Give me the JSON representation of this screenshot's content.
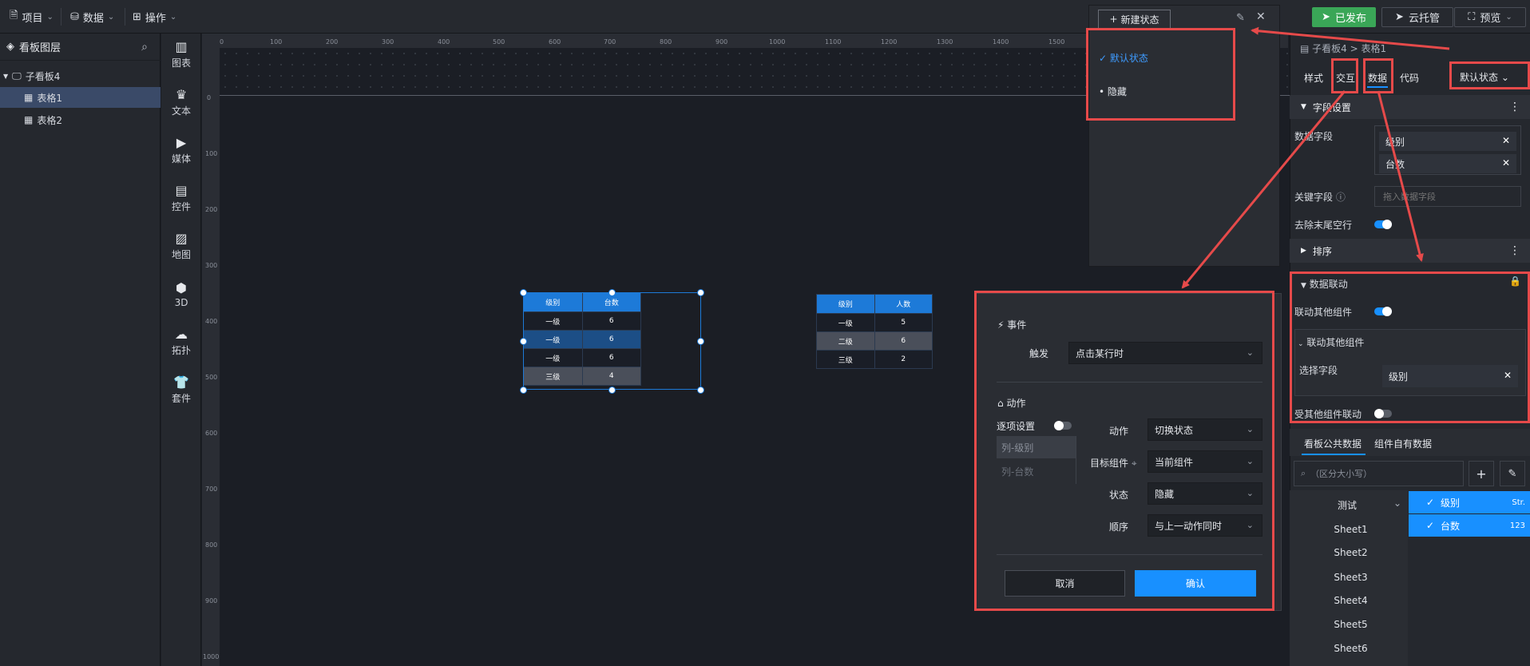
{
  "topbar": {
    "project": "项目",
    "data": "数据",
    "operate": "操作",
    "publish": "已发布",
    "cloud": "云托管",
    "preview": "预览"
  },
  "layers": {
    "title": "看板图层",
    "root": "子看板4",
    "items": [
      "表格1",
      "表格2"
    ]
  },
  "tools": [
    "图表",
    "文本",
    "媒体",
    "控件",
    "地图",
    "3D",
    "拓扑",
    "套件"
  ],
  "ruler": {
    "h": [
      "0",
      "100",
      "200",
      "300",
      "400",
      "500",
      "600",
      "700",
      "800",
      "900",
      "1000",
      "1100",
      "1200",
      "1300",
      "1400",
      "1500"
    ],
    "v": [
      "0",
      "100",
      "200",
      "300",
      "400",
      "500",
      "600",
      "700",
      "800",
      "900",
      "1000"
    ]
  },
  "table1": {
    "headers": [
      "级别",
      "台数"
    ],
    "rows": [
      [
        "一级",
        "6"
      ],
      [
        "一级",
        "6"
      ],
      [
        "一级",
        "6"
      ],
      [
        "三级",
        "4"
      ]
    ]
  },
  "table2": {
    "headers": [
      "级别",
      "人数"
    ],
    "rows": [
      [
        "一级",
        "5"
      ],
      [
        "二级",
        "6"
      ],
      [
        "三级",
        "2"
      ]
    ]
  },
  "state_panel": {
    "new_state": "新建状态",
    "items": [
      "默认状态",
      "隐藏"
    ]
  },
  "modal": {
    "event_title": "事件",
    "trigger_label": "触发",
    "trigger_value": "点击某行时",
    "action_title": "动作",
    "per_item": "逐项设置",
    "columns": [
      "列-级别",
      "列-台数"
    ],
    "action_label": "动作",
    "action_value": "切换状态",
    "target_label": "目标组件",
    "target_value": "当前组件",
    "state_label": "状态",
    "state_value": "隐藏",
    "order_label": "顺序",
    "order_value": "与上一动作同时",
    "cancel": "取消",
    "confirm": "确认"
  },
  "props": {
    "breadcrumb": "子看板4 > 表格1",
    "tabs": [
      "样式",
      "交互",
      "数据",
      "代码"
    ],
    "state_select": "默认状态",
    "field_section": "字段设置",
    "data_fields_label": "数据字段",
    "data_fields": [
      "级别",
      "台数"
    ],
    "key_field_label": "关键字段",
    "key_field_placeholder": "拖入数据字段",
    "remove_trailing": "去除末尾空行",
    "sort_section": "排序",
    "linkage_section": "数据联动",
    "link_others": "联动其他组件",
    "link_others_sub": "联动其他组件",
    "select_field": "选择字段",
    "selected_field": "级别",
    "linked_by_others": "受其他组件联动",
    "data_tabs": [
      "看板公共数据",
      "组件自有数据"
    ],
    "search_placeholder": "（区分大小写）",
    "dataset": "测试",
    "sheets": [
      "Sheet1",
      "Sheet2",
      "Sheet3",
      "Sheet4",
      "Sheet5",
      "Sheet6"
    ],
    "fields": [
      {
        "name": "级别",
        "type": "Str."
      },
      {
        "name": "台数",
        "type": "123"
      }
    ]
  }
}
